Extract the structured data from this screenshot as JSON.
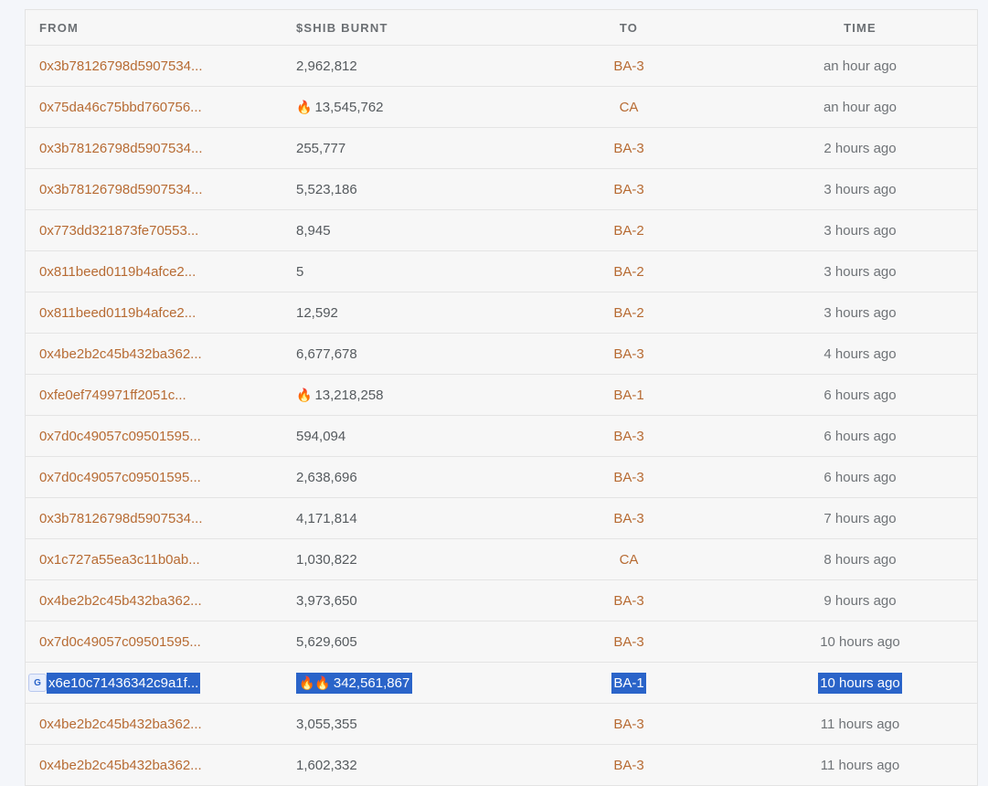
{
  "table": {
    "headers": {
      "from": "FROM",
      "burnt": "$SHIB BURNT",
      "to": "TO",
      "time": "TIME"
    },
    "rows": [
      {
        "from": "0x3b78126798d5907534...",
        "fire": "",
        "burnt": "2,962,812",
        "to": "BA-3",
        "time": "an hour ago"
      },
      {
        "from": "0x75da46c75bbd760756...",
        "fire": "🔥",
        "burnt": "13,545,762",
        "to": "CA",
        "time": "an hour ago"
      },
      {
        "from": "0x3b78126798d5907534...",
        "fire": "",
        "burnt": "255,777",
        "to": "BA-3",
        "time": "2 hours ago"
      },
      {
        "from": "0x3b78126798d5907534...",
        "fire": "",
        "burnt": "5,523,186",
        "to": "BA-3",
        "time": "3 hours ago"
      },
      {
        "from": "0x773dd321873fe70553...",
        "fire": "",
        "burnt": "8,945",
        "to": "BA-2",
        "time": "3 hours ago"
      },
      {
        "from": "0x811beed0119b4afce2...",
        "fire": "",
        "burnt": "5",
        "to": "BA-2",
        "time": "3 hours ago"
      },
      {
        "from": "0x811beed0119b4afce2...",
        "fire": "",
        "burnt": "12,592",
        "to": "BA-2",
        "time": "3 hours ago"
      },
      {
        "from": "0x4be2b2c45b432ba362...",
        "fire": "",
        "burnt": "6,677,678",
        "to": "BA-3",
        "time": "4 hours ago"
      },
      {
        "from": "0xfe0ef749971ff2051c...",
        "fire": "🔥",
        "burnt": "13,218,258",
        "to": "BA-1",
        "time": "6 hours ago"
      },
      {
        "from": "0x7d0c49057c09501595...",
        "fire": "",
        "burnt": "594,094",
        "to": "BA-3",
        "time": "6 hours ago"
      },
      {
        "from": "0x7d0c49057c09501595...",
        "fire": "",
        "burnt": "2,638,696",
        "to": "BA-3",
        "time": "6 hours ago"
      },
      {
        "from": "0x3b78126798d5907534...",
        "fire": "",
        "burnt": "4,171,814",
        "to": "BA-3",
        "time": "7 hours ago"
      },
      {
        "from": "0x1c727a55ea3c11b0ab...",
        "fire": "",
        "burnt": "1,030,822",
        "to": "CA",
        "time": "8 hours ago"
      },
      {
        "from": "0x4be2b2c45b432ba362...",
        "fire": "",
        "burnt": "3,973,650",
        "to": "BA-3",
        "time": "9 hours ago"
      },
      {
        "from": "0x7d0c49057c09501595...",
        "fire": "",
        "burnt": "5,629,605",
        "to": "BA-3",
        "time": "10 hours ago"
      },
      {
        "from": "x6e10c71436342c9a1f...",
        "fire": "🔥🔥",
        "burnt": "342,561,867",
        "to": "BA-1",
        "time": "10 hours ago",
        "selected": true
      },
      {
        "from": "0x4be2b2c45b432ba362...",
        "fire": "",
        "burnt": "3,055,355",
        "to": "BA-3",
        "time": "11 hours ago"
      },
      {
        "from": "0x4be2b2c45b432ba362...",
        "fire": "",
        "burnt": "1,602,332",
        "to": "BA-3",
        "time": "11 hours ago"
      }
    ]
  },
  "translate_popup_icon": "translate-icon",
  "colors": {
    "link": "#b76b33",
    "selection": "#2a64c9"
  }
}
